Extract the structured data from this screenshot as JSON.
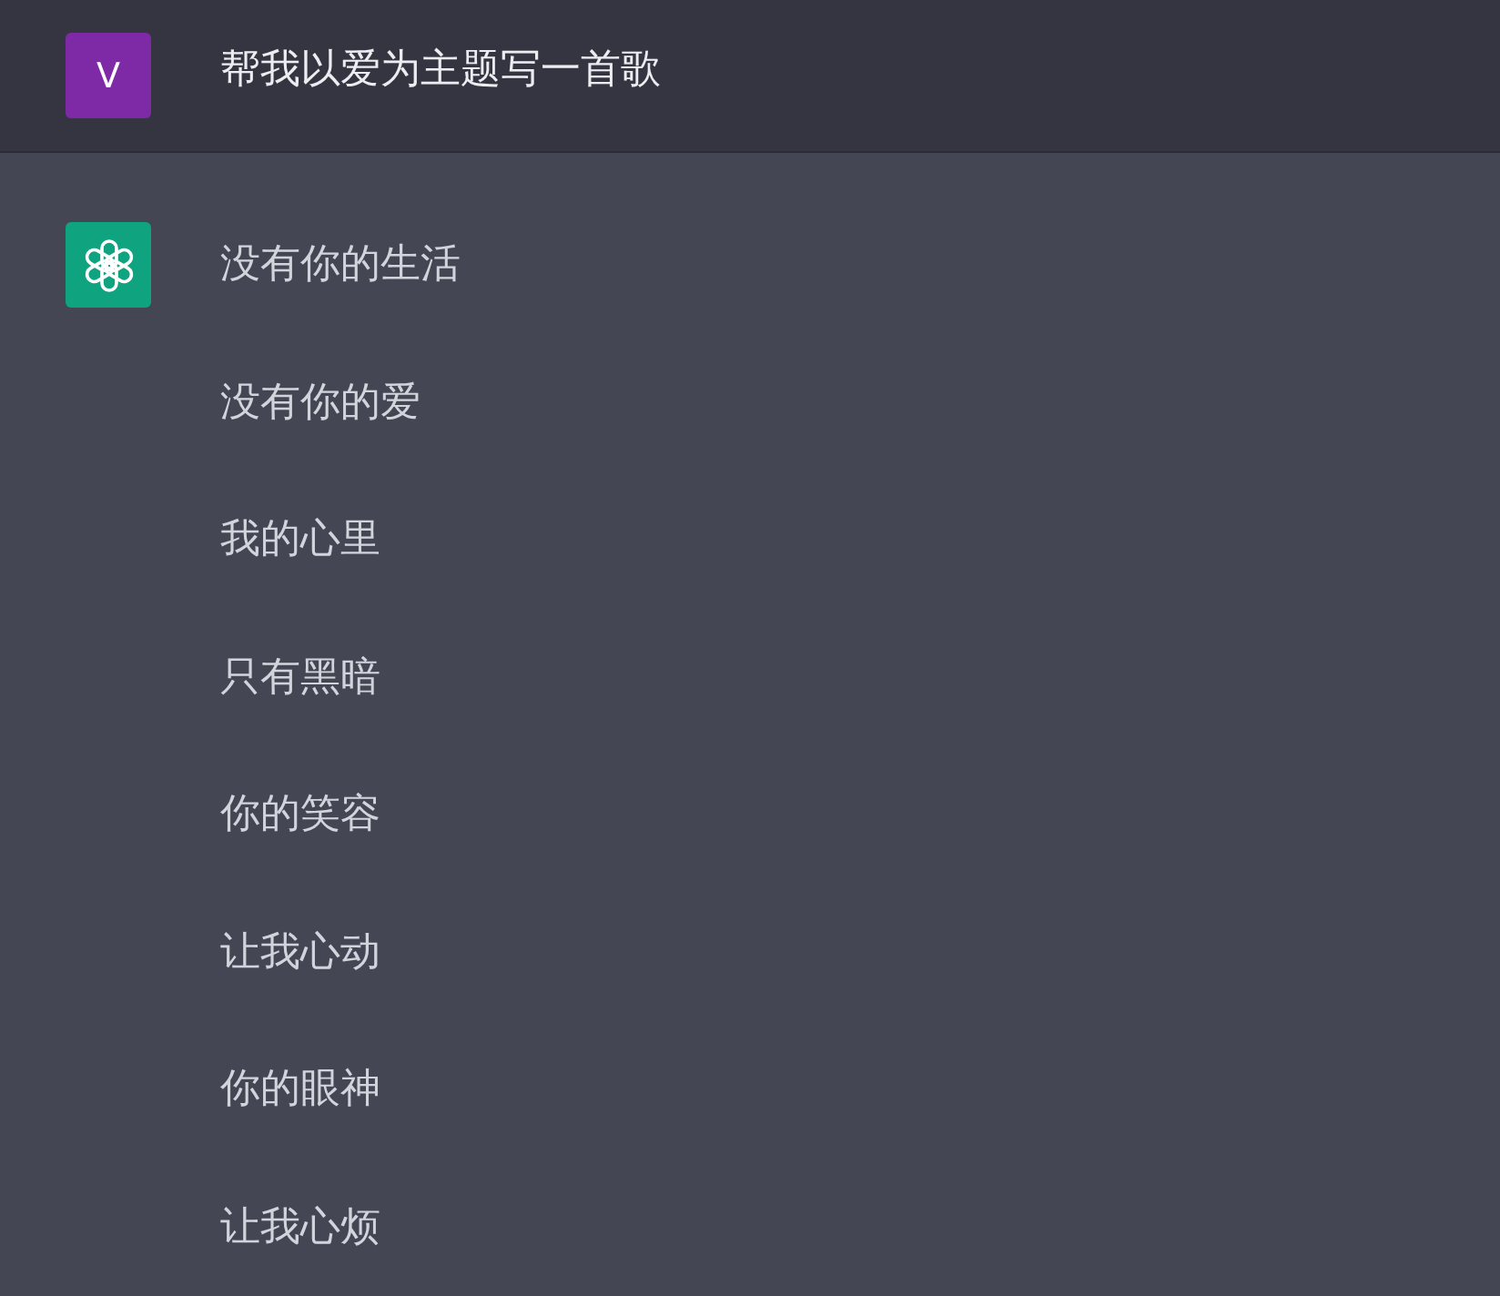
{
  "user_message": {
    "avatar": "V",
    "text": "帮我以爱为主题写一首歌"
  },
  "assistant_message": {
    "lines": [
      "没有你的生活",
      "没有你的爱",
      "我的心里",
      "只有黑暗",
      "你的笑容",
      "让我心动",
      "你的眼神",
      "让我心烦"
    ]
  }
}
